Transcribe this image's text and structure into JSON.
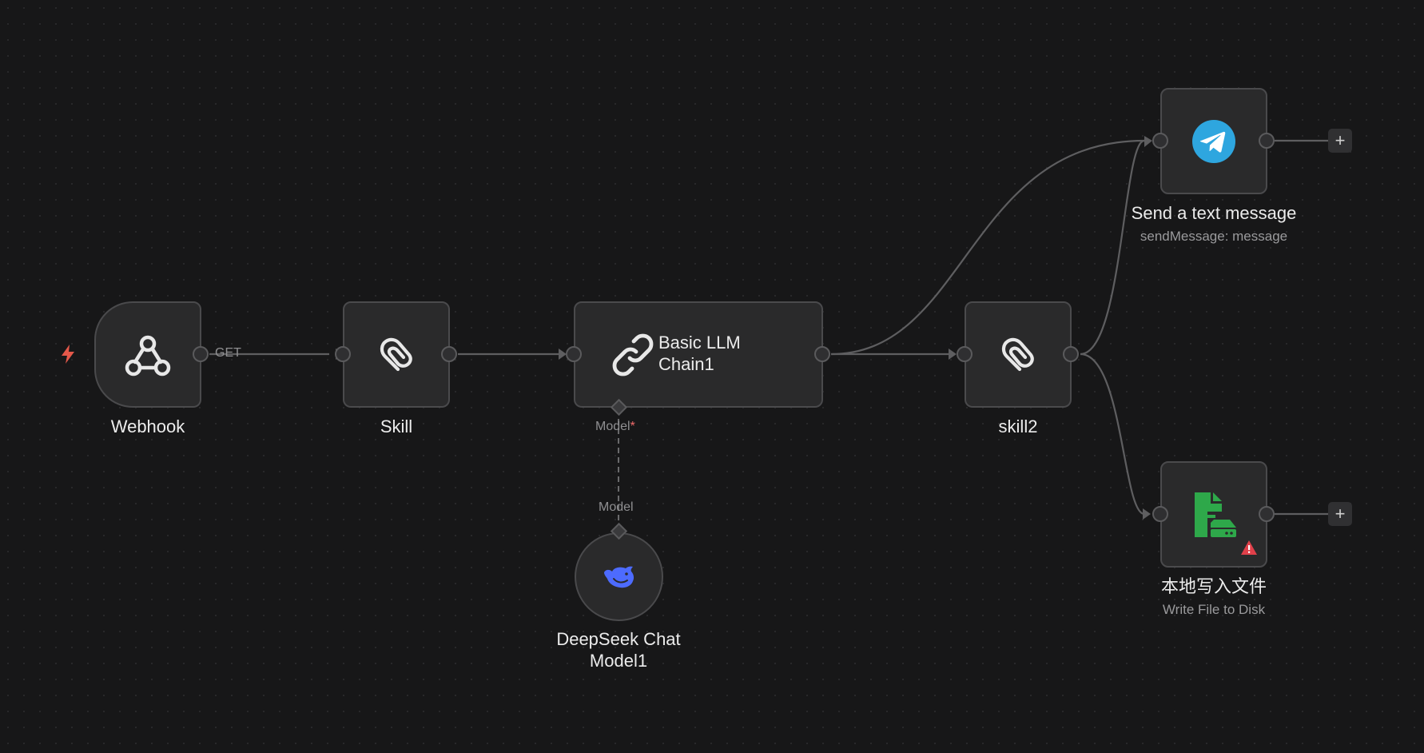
{
  "nodes": {
    "webhook": {
      "label": "Webhook"
    },
    "skill": {
      "label": "Skill"
    },
    "llm_chain": {
      "label_line1": "Basic LLM",
      "label_line2": "Chain1"
    },
    "skill2": {
      "label": "skill2"
    },
    "telegram": {
      "label": "Send a text message",
      "sublabel": "sendMessage: message"
    },
    "write_file": {
      "label": "本地写入文件",
      "sublabel": "Write File to Disk"
    },
    "deepseek": {
      "label_line1": "DeepSeek Chat",
      "label_line2": "Model1"
    }
  },
  "connections": {
    "webhook_output_label": "GET",
    "chain_model_input_label": "Model",
    "chain_model_required_mark": "*",
    "deepseek_output_label": "Model"
  },
  "buttons": {
    "add_node": "+"
  },
  "colors": {
    "trigger": "#e4584a",
    "telegram": "#2ea6df",
    "write_file": "#2ea84a",
    "warning": "#e0404a",
    "deepseek": "#4d6bfe"
  },
  "icons": {
    "trigger": "lightning-bolt-icon",
    "webhook": "webhook-icon",
    "skill": "paperclip-icon",
    "llm_chain": "link-icon",
    "skill2": "paperclip-icon",
    "telegram": "telegram-plane-icon",
    "write_file": "file-to-disk-icon",
    "warning": "warning-triangle-icon",
    "deepseek": "deepseek-whale-icon"
  }
}
